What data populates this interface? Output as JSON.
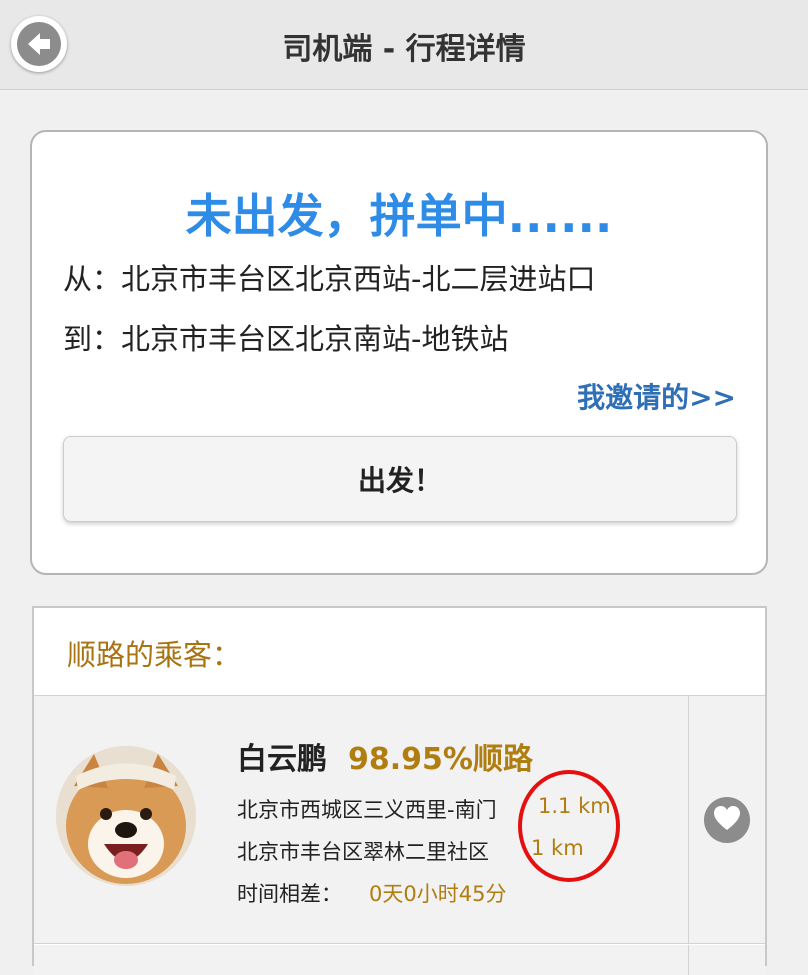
{
  "header": {
    "title": "司机端 - 行程详情",
    "back_icon": "arrow-left-circle-icon"
  },
  "trip": {
    "status": "未出发，拼单中......",
    "from_label": "从：",
    "from_address": "北京市丰台区北京西站-北二层进站口",
    "to_label": "到：",
    "to_address": "北京市丰台区北京南站-地铁站",
    "invite_link": "我邀请的>>",
    "depart_button": "出发！"
  },
  "passengers": {
    "header": "顺路的乘客：",
    "items": [
      {
        "name": "白云鹏",
        "match_rate": "98.95%顺路",
        "pickup_address": "北京市西城区三义西里-南门",
        "pickup_distance": "1.1 km",
        "dropoff_address": "北京市丰台区翠林二里社区",
        "dropoff_distance": "1 km",
        "time_label": "时间相差：",
        "time_value": "0天0小时45分",
        "avatar_icon": "dog-avatar",
        "favorite_icon": "heart-icon"
      }
    ]
  },
  "colors": {
    "status_blue": "#2e8be6",
    "link_blue": "#2f6fb5",
    "accent_gold": "#b07d10",
    "annotation_red": "#e41010",
    "header_bg": "#e8e8e8"
  }
}
